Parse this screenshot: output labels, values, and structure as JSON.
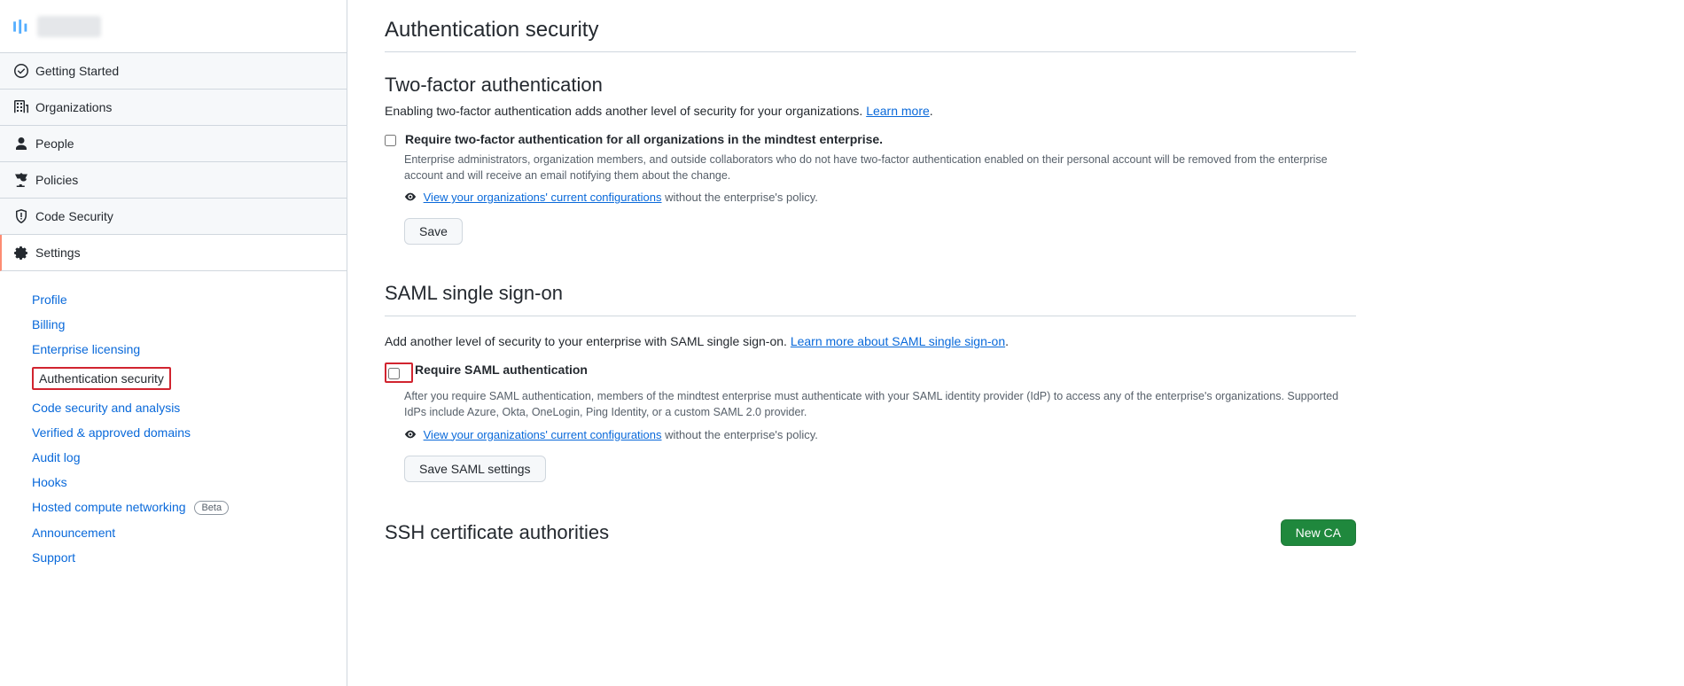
{
  "sidebar": {
    "nav": [
      {
        "label": "Getting Started"
      },
      {
        "label": "Organizations"
      },
      {
        "label": "People"
      },
      {
        "label": "Policies"
      },
      {
        "label": "Code Security"
      },
      {
        "label": "Settings"
      }
    ],
    "subnav": [
      {
        "label": "Profile"
      },
      {
        "label": "Billing"
      },
      {
        "label": "Enterprise licensing"
      },
      {
        "label": "Authentication security"
      },
      {
        "label": "Code security and analysis"
      },
      {
        "label": "Verified & approved domains"
      },
      {
        "label": "Audit log"
      },
      {
        "label": "Hooks"
      },
      {
        "label": "Hosted compute networking",
        "badge": "Beta"
      },
      {
        "label": "Announcement"
      },
      {
        "label": "Support"
      }
    ]
  },
  "page": {
    "title": "Authentication security"
  },
  "twofa": {
    "heading": "Two-factor authentication",
    "intro_prefix": "Enabling two-factor authentication adds another level of security for your organizations. ",
    "intro_link": "Learn more",
    "intro_suffix": ".",
    "checkbox_label": "Require two-factor authentication for all organizations in the mindtest enterprise.",
    "help": "Enterprise administrators, organization members, and outside collaborators who do not have two-factor authentication enabled on their personal account will be removed from the enterprise account and will receive an email notifying them about the change.",
    "view_link": "View your organizations' current configurations",
    "view_trail": " without the enterprise's policy.",
    "save_label": "Save"
  },
  "saml": {
    "heading": "SAML single sign-on",
    "intro_prefix": "Add another level of security to your enterprise with SAML single sign-on. ",
    "intro_link": "Learn more about SAML single sign-on",
    "intro_suffix": ".",
    "checkbox_label": "Require SAML authentication",
    "help": "After you require SAML authentication, members of the mindtest enterprise must authenticate with your SAML identity provider (IdP) to access any of the enterprise's organizations. Supported IdPs include Azure, Okta, OneLogin, Ping Identity, or a custom SAML 2.0 provider.",
    "view_link": "View your organizations' current configurations",
    "view_trail": " without the enterprise's policy.",
    "save_label": "Save SAML settings"
  },
  "ssh": {
    "heading": "SSH certificate authorities",
    "new_ca_label": "New CA"
  }
}
